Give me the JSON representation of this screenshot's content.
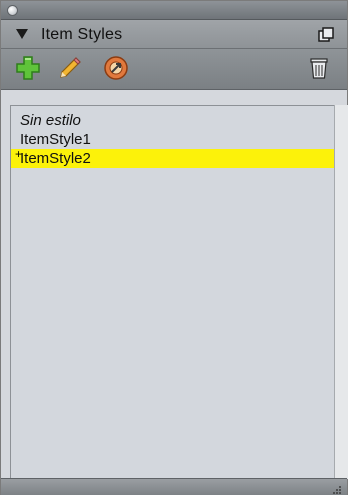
{
  "panel": {
    "title": "Item Styles"
  },
  "toolbar": {
    "new_icon": "add-style-icon",
    "edit_icon": "edit-pencil-icon",
    "duplicate_icon": "duplicate-style-icon",
    "delete_icon": "trash-icon"
  },
  "styles": [
    {
      "label": "Sin estilo",
      "italic": true,
      "selected": false,
      "modified": false
    },
    {
      "label": "ItemStyle1",
      "italic": false,
      "selected": false,
      "modified": false
    },
    {
      "label": "ItemStyle2",
      "italic": false,
      "selected": true,
      "modified": true,
      "modified_mark": "+"
    }
  ],
  "colors": {
    "selection": "#fcf20a",
    "panel_bg": "#d5d8dd",
    "header_bg": "#9095a0"
  }
}
